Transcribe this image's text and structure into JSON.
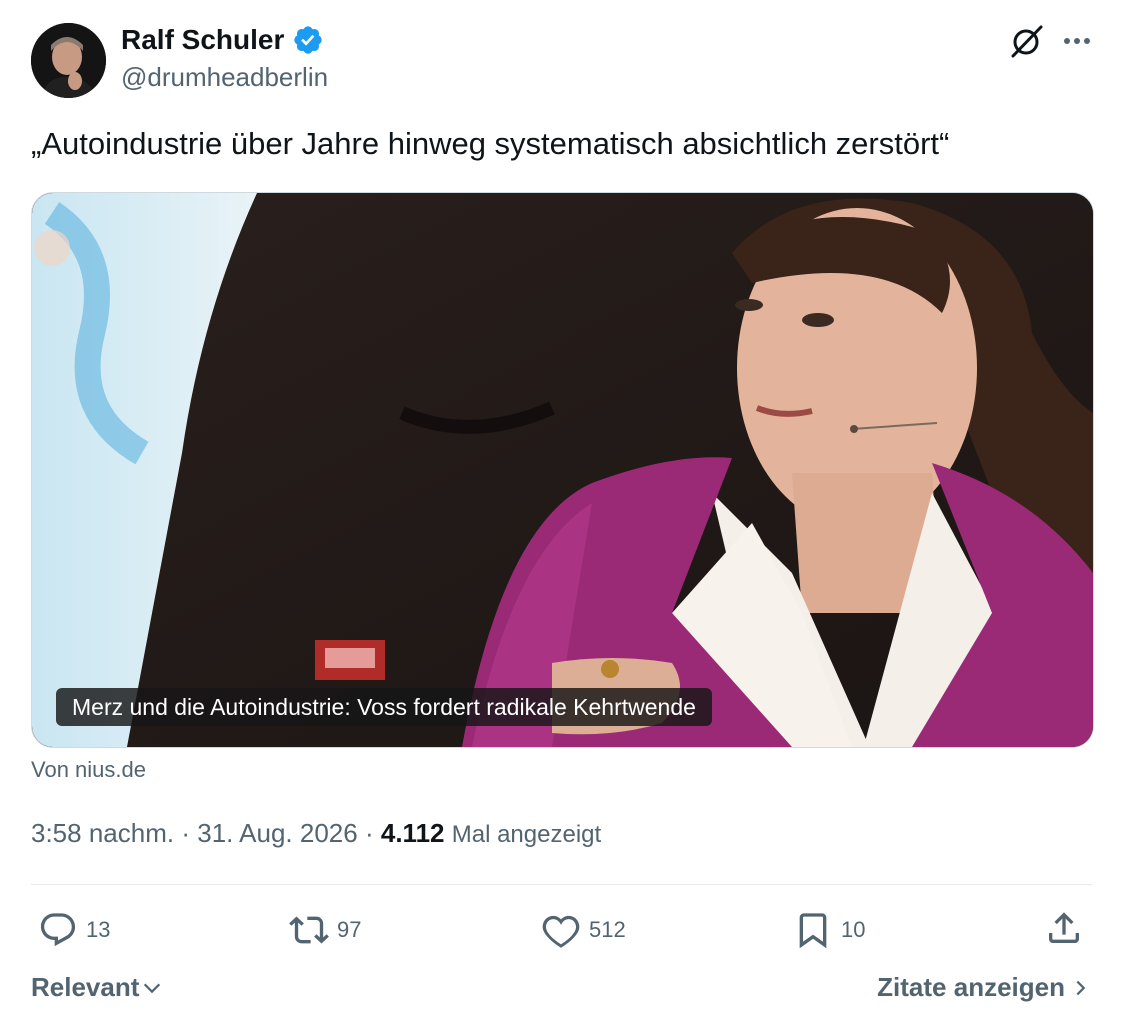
{
  "author": {
    "name": "Ralf Schuler",
    "handle": "@drumheadberlin",
    "verified": true,
    "verified_color": "#1d9bf0"
  },
  "icons": {
    "grok": "grok-slash-icon",
    "more": "more-dots-icon",
    "reply": "reply-bubble-icon",
    "retweet": "retweet-arrows-icon",
    "like": "heart-icon",
    "bookmark": "bookmark-icon",
    "share": "share-upload-icon"
  },
  "tweet": {
    "text": "„Autoindustrie über Jahre hinweg systematisch absichtlich zerstört“"
  },
  "media": {
    "caption": "Merz und die Autoindustrie: Voss fordert radikale Kehrtwende",
    "source": "Von nius.de"
  },
  "meta": {
    "time": "3:58 nachm.",
    "separator": "·",
    "date": "31. Aug. 2026",
    "views_count": "4.112",
    "views_label": "Mal angezeigt"
  },
  "actions": {
    "replies": "13",
    "retweets": "97",
    "likes": "512",
    "bookmarks": "10"
  },
  "footer": {
    "sort_label": "Relevant",
    "quotes_label": "Zitate anzeigen"
  },
  "colors": {
    "text_primary": "#0f1419",
    "text_secondary": "#536471",
    "divider": "#e7e9ea",
    "jacket": "#9b2a76"
  }
}
